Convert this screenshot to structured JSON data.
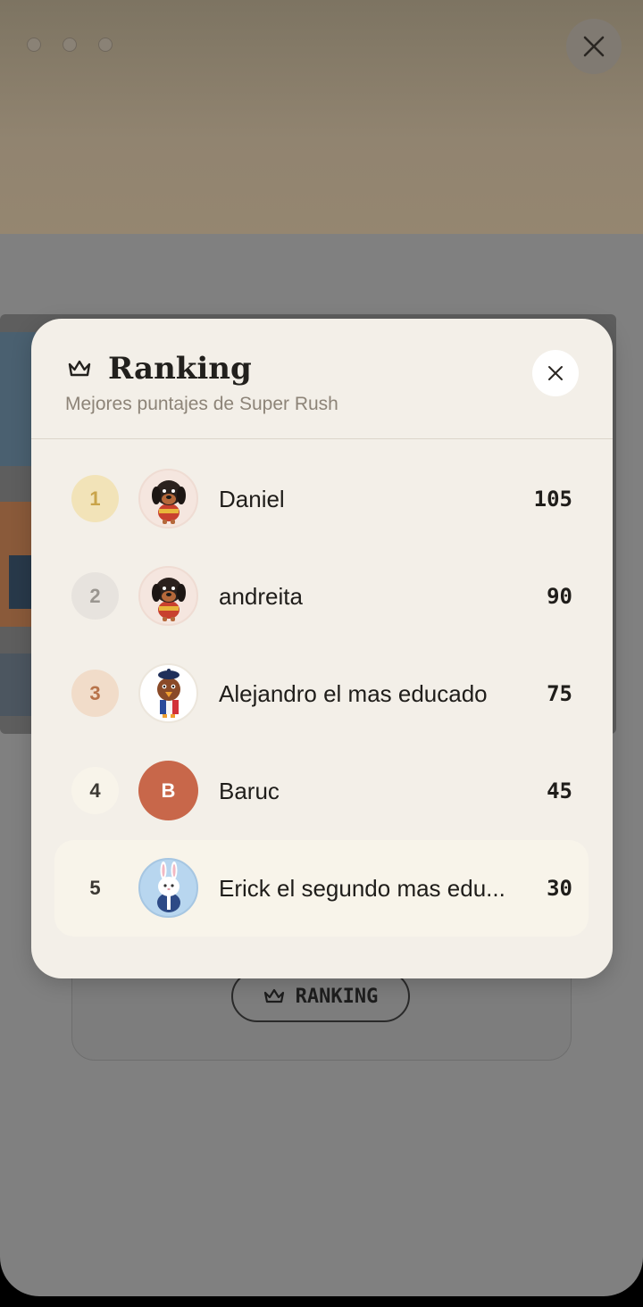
{
  "background": {
    "top_close_icon": "close-icon",
    "ranking_button_label": "RANKING"
  },
  "modal": {
    "title": "Ranking",
    "subtitle": "Mejores puntajes de Super Rush",
    "title_icon": "crown-icon",
    "close_icon": "close-icon"
  },
  "ranking": [
    {
      "rank": "1",
      "name": "Daniel",
      "score": "105",
      "avatar": "dachshund-avatar",
      "badge_bg": "#f2e3b8",
      "badge_fg": "#c9a44a"
    },
    {
      "rank": "2",
      "name": "andreita",
      "score": "90",
      "avatar": "dachshund-avatar",
      "badge_bg": "#e7e3de",
      "badge_fg": "#9a9690"
    },
    {
      "rank": "3",
      "name": "Alejandro el mas educado",
      "score": "75",
      "avatar": "bird-beret-avatar",
      "badge_bg": "#f1dcc9",
      "badge_fg": "#b8734a"
    },
    {
      "rank": "4",
      "name": "Baruc",
      "score": "45",
      "avatar": "letter-avatar",
      "avatar_letter": "B",
      "badge_bg": "#f8f4ea",
      "badge_fg": "#3b3833"
    },
    {
      "rank": "5",
      "name": "Erick el segundo mas edu...",
      "score": "30",
      "avatar": "rabbit-avatar",
      "badge_bg": "transparent",
      "badge_fg": "#3b3833",
      "highlighted": true
    }
  ],
  "colors": {
    "letter_avatar_bg": "#c8674a"
  }
}
